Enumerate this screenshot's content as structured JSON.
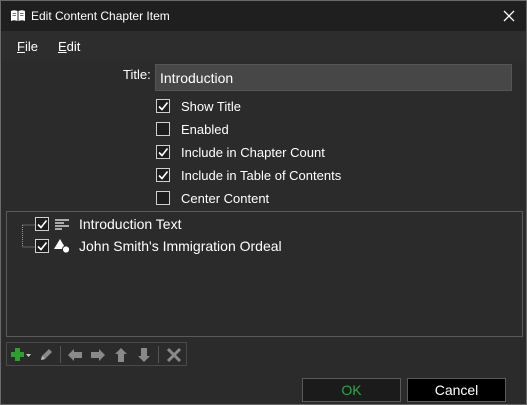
{
  "window": {
    "title": "Edit Content Chapter Item"
  },
  "menu": [
    {
      "mnemonic": "F",
      "rest": "ile"
    },
    {
      "mnemonic": "E",
      "rest": "dit"
    }
  ],
  "form": {
    "title_label": "Title:",
    "title_value": "Introduction",
    "options": [
      {
        "label": "Show Title",
        "checked": true
      },
      {
        "label": "Enabled",
        "checked": false
      },
      {
        "label": "Include in Chapter Count",
        "checked": true
      },
      {
        "label": "Include in Table of Contents",
        "checked": true
      },
      {
        "label": "Center Content",
        "checked": false
      }
    ]
  },
  "tree": {
    "items": [
      {
        "label": "Introduction Text",
        "checked": true,
        "icon": "text-lines-icon"
      },
      {
        "label": "John Smith's Immigration Ordeal",
        "checked": true,
        "icon": "shapes-icon"
      }
    ]
  },
  "toolbar": {
    "icons": [
      "add-icon",
      "dropdown-arrow-icon",
      "edit-pencil-icon",
      "move-left-icon",
      "move-right-icon",
      "move-up-icon",
      "move-down-icon",
      "delete-icon"
    ]
  },
  "buttons": {
    "ok": "OK",
    "cancel": "Cancel"
  },
  "colors": {
    "ok_text": "#2aa84a",
    "add_icon": "#2e9e2e",
    "background": "#2b2b2b"
  }
}
